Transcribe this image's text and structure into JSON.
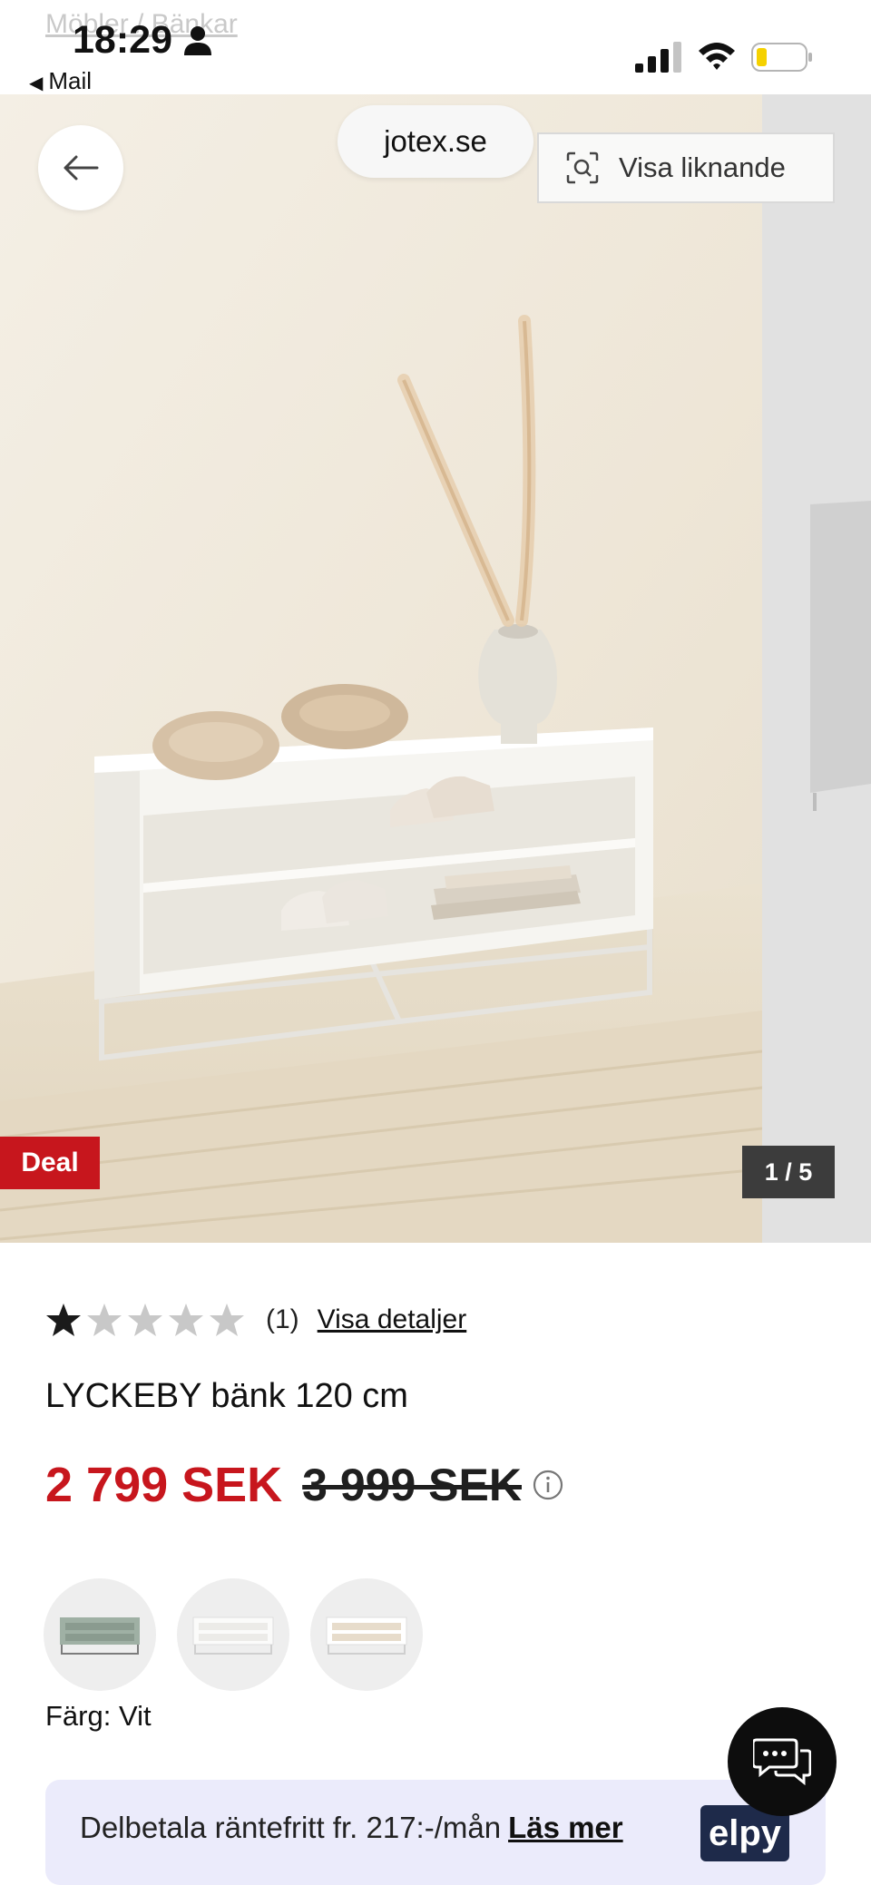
{
  "status_bar": {
    "time": "18:29",
    "back_app": "Mail",
    "breadcrumb_hint": "Möbler / Bänkar"
  },
  "browser": {
    "url": "jotex.se"
  },
  "gallery": {
    "similar_label": "Visa liknande",
    "deal_badge": "Deal",
    "counter": "1 / 5"
  },
  "product": {
    "rating": {
      "stars_filled": 1,
      "stars_total": 5,
      "count": "(1)",
      "details_link": "Visa detaljer"
    },
    "name": "LYCKEBY bänk 120 cm",
    "price_now": "2 799 SEK",
    "price_old": "3 999 SEK",
    "color_label": "Färg: Vit",
    "swatches": [
      {
        "name": "green",
        "color": "#9fb0a4"
      },
      {
        "name": "white",
        "color": "#f2f2f0"
      },
      {
        "name": "white-oak",
        "color": "#e7dccb"
      }
    ]
  },
  "installment": {
    "text": "Delbetala räntefritt fr. 217:-/mån",
    "link": "Läs mer",
    "brand": "elpy"
  },
  "colors": {
    "accent_red": "#c7161d",
    "installment_bg": "#ebebfb",
    "elpy_navy": "#1e2a4a"
  }
}
